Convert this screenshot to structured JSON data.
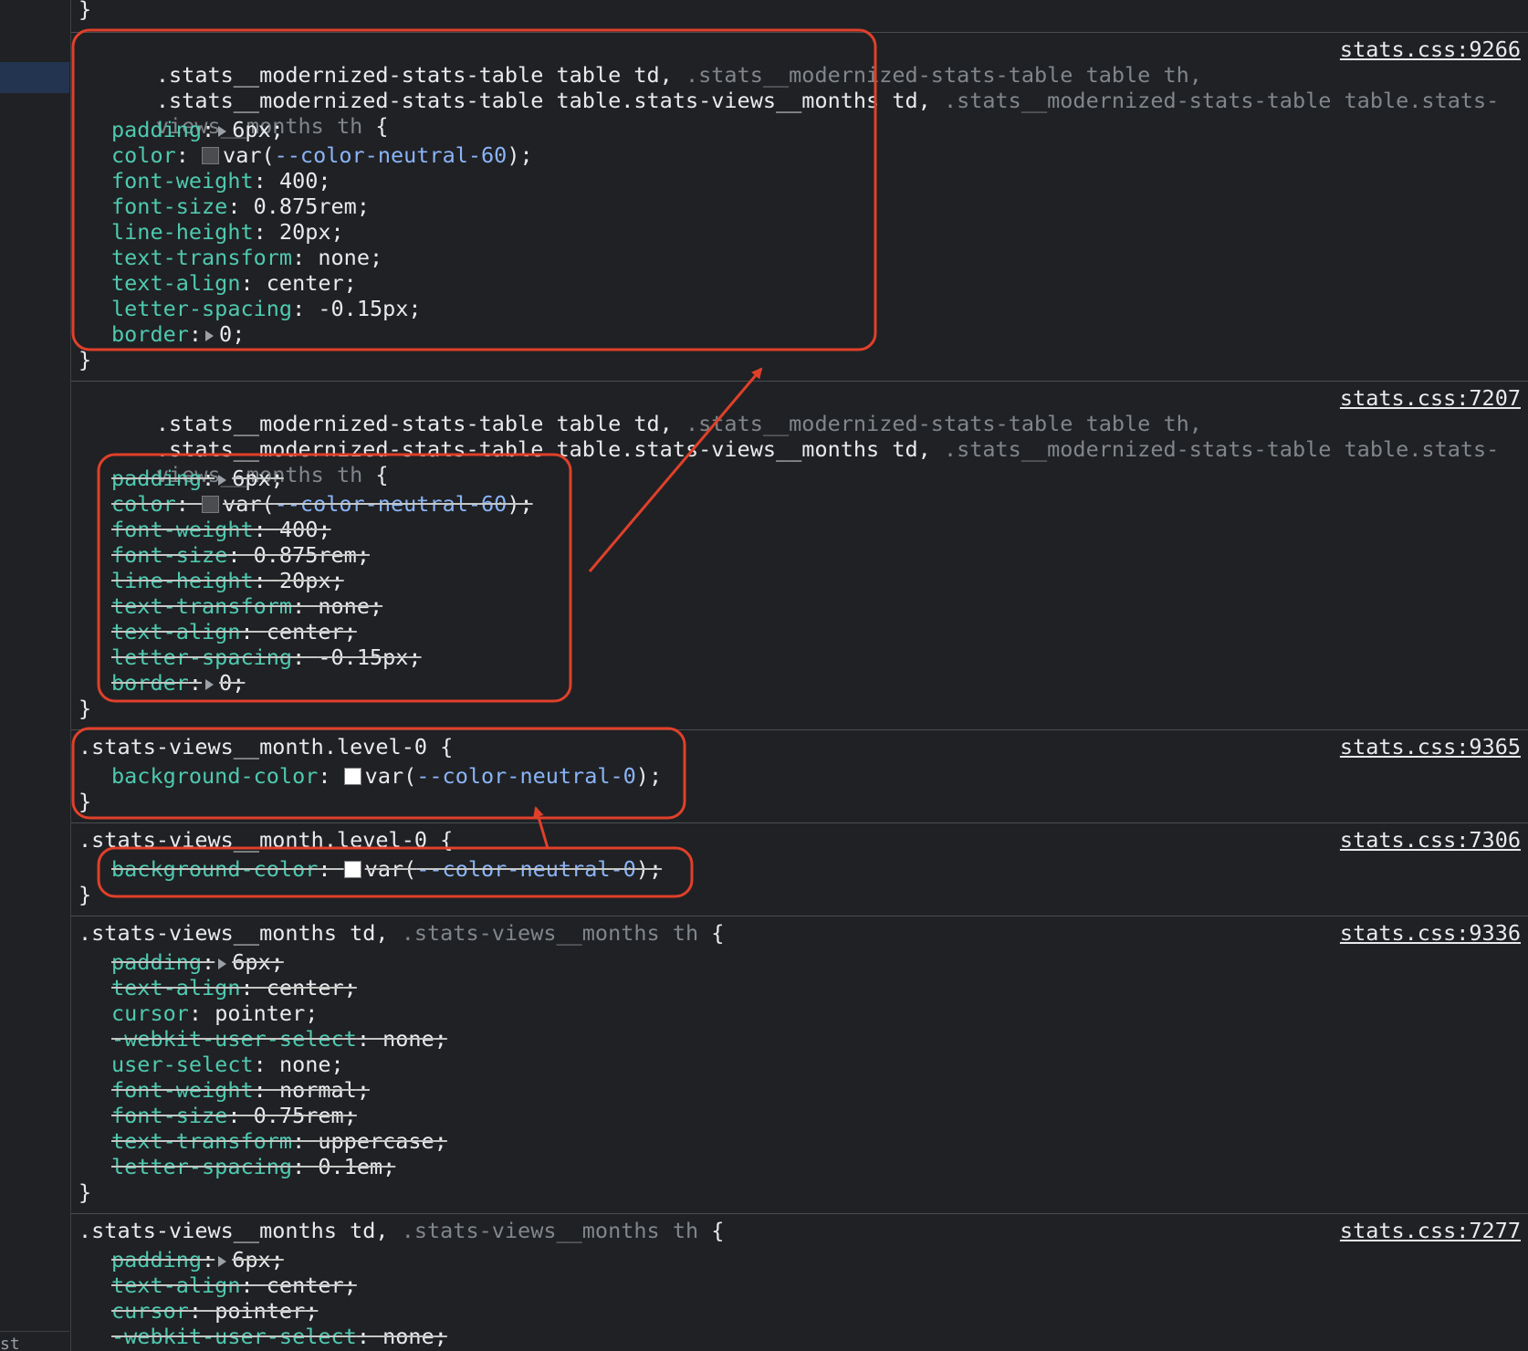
{
  "gutter": {
    "bottom_text": "st"
  },
  "closing_brace": "}",
  "rules": [
    {
      "source": "stats.css:9266",
      "selector_l1_a": ".stats__modernized-stats-table table td,",
      "selector_l1_b": " .stats__modernized-stats-table table th,",
      "selector_l2_a": ".stats__modernized-stats-table table.stats-views__months td,",
      "selector_l2_b": " .stats__modernized-stats-table table.stats-",
      "selector_l3_a": "views__months th",
      "selector_l3_b": " {",
      "decls": [
        {
          "name": "padding",
          "value": "6px",
          "expand": true
        },
        {
          "name": "color",
          "var": "--color-neutral-60",
          "swatch": "#4a4c50"
        },
        {
          "name": "font-weight",
          "value": "400"
        },
        {
          "name": "font-size",
          "value": "0.875rem"
        },
        {
          "name": "line-height",
          "value": "20px"
        },
        {
          "name": "text-transform",
          "value": "none"
        },
        {
          "name": "text-align",
          "value": "center"
        },
        {
          "name": "letter-spacing",
          "value": "-0.15px"
        },
        {
          "name": "border",
          "value": "0",
          "expand": true
        }
      ]
    },
    {
      "source": "stats.css:7207",
      "selector_l1_a": ".stats__modernized-stats-table table td,",
      "selector_l1_b": " .stats__modernized-stats-table table th,",
      "selector_l2_a": ".stats__modernized-stats-table table.stats-views__months td,",
      "selector_l2_b": " .stats__modernized-stats-table table.stats-",
      "selector_l3_a": "views__months th",
      "selector_l3_b": " {",
      "decls": [
        {
          "name": "padding",
          "value": "6px"
        },
        {
          "name": "color",
          "var": "--color-neutral-60"
        },
        {
          "name": "font-weight",
          "value": "400"
        },
        {
          "name": "font-size",
          "value": "0.875rem"
        },
        {
          "name": "line-height",
          "value": "20px"
        },
        {
          "name": "text-transform",
          "value": "none"
        },
        {
          "name": "text-align",
          "value": "center"
        },
        {
          "name": "letter-spacing",
          "value": "-0.15px"
        },
        {
          "name": "border",
          "value": "0"
        }
      ]
    },
    {
      "source": "stats.css:9365",
      "selector": ".stats-views__month.level-0 {",
      "decls": [
        {
          "name": "background-color",
          "var": "--color-neutral-0"
        }
      ]
    },
    {
      "source": "stats.css:7306",
      "selector": ".stats-views__month.level-0 {",
      "decls": [
        {
          "name": "background-color",
          "var": "--color-neutral-0"
        }
      ]
    },
    {
      "source": "stats.css:9336",
      "selector_a": ".stats-views__months td,",
      "selector_b": " .stats-views__months th",
      "selector_c": " {",
      "decls": [
        {
          "name": "padding",
          "value": "6px"
        },
        {
          "name": "text-align",
          "value": "center"
        },
        {
          "name": "cursor",
          "value": "pointer"
        },
        {
          "name": "-webkit-user-select",
          "value": "none"
        },
        {
          "name": "user-select",
          "value": "none"
        },
        {
          "name": "font-weight",
          "value": "normal"
        },
        {
          "name": "font-size",
          "value": "0.75rem"
        },
        {
          "name": "text-transform",
          "value": "uppercase"
        },
        {
          "name": "letter-spacing",
          "value": "0.1em"
        }
      ]
    },
    {
      "source": "stats.css:7277",
      "selector_a": ".stats-views__months td,",
      "selector_b": " .stats-views__months th",
      "selector_c": " {",
      "decls": [
        {
          "name": "padding",
          "value": "6px"
        },
        {
          "name": "text-align",
          "value": "center"
        },
        {
          "name": "cursor",
          "value": "pointer"
        },
        {
          "name": "-webkit-user-select",
          "value": "none"
        }
      ]
    }
  ],
  "annotation_color": "#e0402a"
}
